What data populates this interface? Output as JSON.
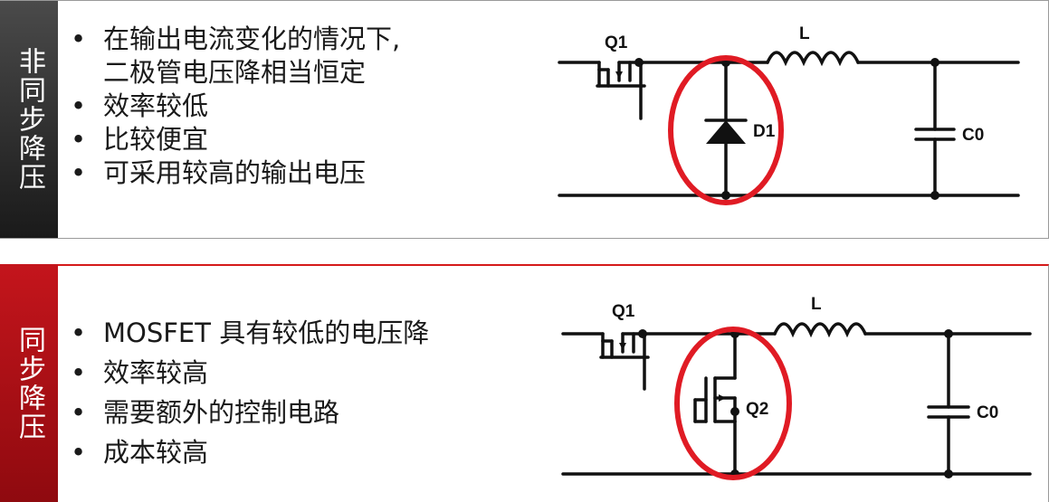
{
  "top_section": {
    "tab_label": "非同步降压",
    "bullets": [
      {
        "lines": [
          "在输出电流变化的情况下,",
          "二极管电压降相当恒定"
        ]
      },
      {
        "lines": [
          "效率较低"
        ]
      },
      {
        "lines": [
          "比较便宜"
        ]
      },
      {
        "lines": [
          "可采用较高的输出电压"
        ]
      }
    ],
    "circuit": {
      "labels": {
        "switch": "Q1",
        "inductor": "L",
        "diode": "D1",
        "capacitor": "C0"
      }
    }
  },
  "bottom_section": {
    "tab_label": "同步降压",
    "bullets": [
      {
        "lines": [
          "MOSFET 具有较低的电压降"
        ]
      },
      {
        "lines": [
          "效率较高"
        ]
      },
      {
        "lines": [
          "需要额外的控制电路"
        ]
      },
      {
        "lines": [
          "成本较高"
        ]
      }
    ],
    "circuit": {
      "labels": {
        "switch": "Q1",
        "inductor": "L",
        "low_side_switch": "Q2",
        "capacitor": "C0"
      }
    }
  },
  "colors": {
    "tab_dark": "#2a2a2a",
    "tab_red": "#b5121b",
    "highlight_ring": "#e01b24",
    "wire": "#111111"
  }
}
